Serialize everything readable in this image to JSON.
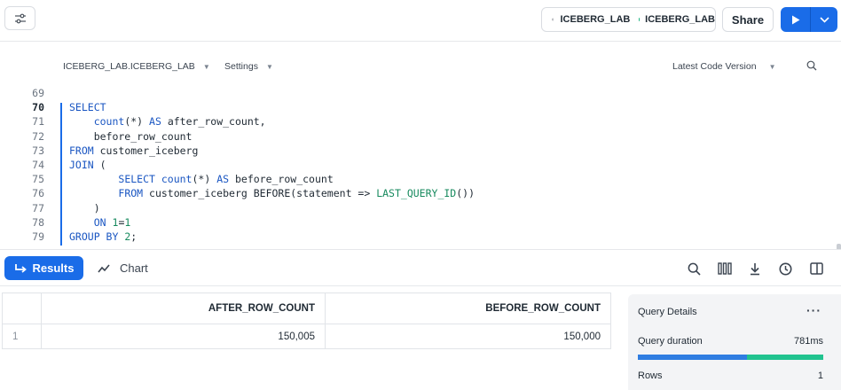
{
  "topbar": {
    "context_role": "ICEBERG_LAB",
    "context_warehouse": "ICEBERG_LAB",
    "share_label": "Share"
  },
  "worksheet": {
    "database": "ICEBERG_LAB.ICEBERG_LAB",
    "settings_label": "Settings",
    "version_label": "Latest Code Version"
  },
  "editor": {
    "line_numbers": [
      "69",
      "70",
      "71",
      "72",
      "73",
      "74",
      "75",
      "76",
      "77",
      "78",
      "79"
    ],
    "active_line": "70"
  },
  "results_bar": {
    "results_label": "Results",
    "chart_label": "Chart"
  },
  "grid": {
    "columns": [
      "AFTER_ROW_COUNT",
      "BEFORE_ROW_COUNT"
    ],
    "rows": [
      {
        "index": "1",
        "after": "150,005",
        "before": "150,000"
      }
    ]
  },
  "query_details": {
    "title": "Query Details",
    "duration_label": "Query duration",
    "duration_value": "781ms",
    "duration_split_fraction": 0.59,
    "rows_label": "Rows",
    "rows_value": "1"
  },
  "colors": {
    "accent": "#1a6ce8",
    "keyword": "#1a56c2",
    "literal": "#178a5e"
  }
}
